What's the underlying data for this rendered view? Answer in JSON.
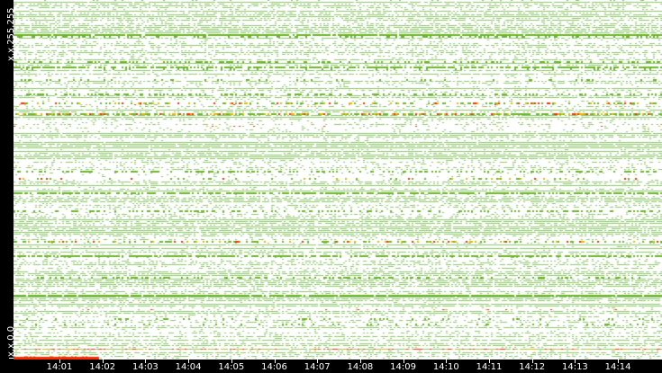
{
  "chart_data": {
    "type": "heatmap",
    "title": "",
    "xlabel": "",
    "ylabel": "",
    "x_ticks": [
      "14:01",
      "14:02",
      "14:03",
      "14:04",
      "14:05",
      "14:06",
      "14:07",
      "14:08",
      "14:09",
      "14:10",
      "14:11",
      "14:12",
      "14:13",
      "14:14"
    ],
    "y_labels": {
      "top": "x.x.255.255",
      "bottom": "x.x.0.0"
    },
    "colors": {
      "low": "#8dc86a",
      "mid": "#6cb52a",
      "high_mid": "#f0b400",
      "high": "#ff2a00",
      "background": "#ffffff",
      "axis": "#000000"
    },
    "grid": false
  }
}
